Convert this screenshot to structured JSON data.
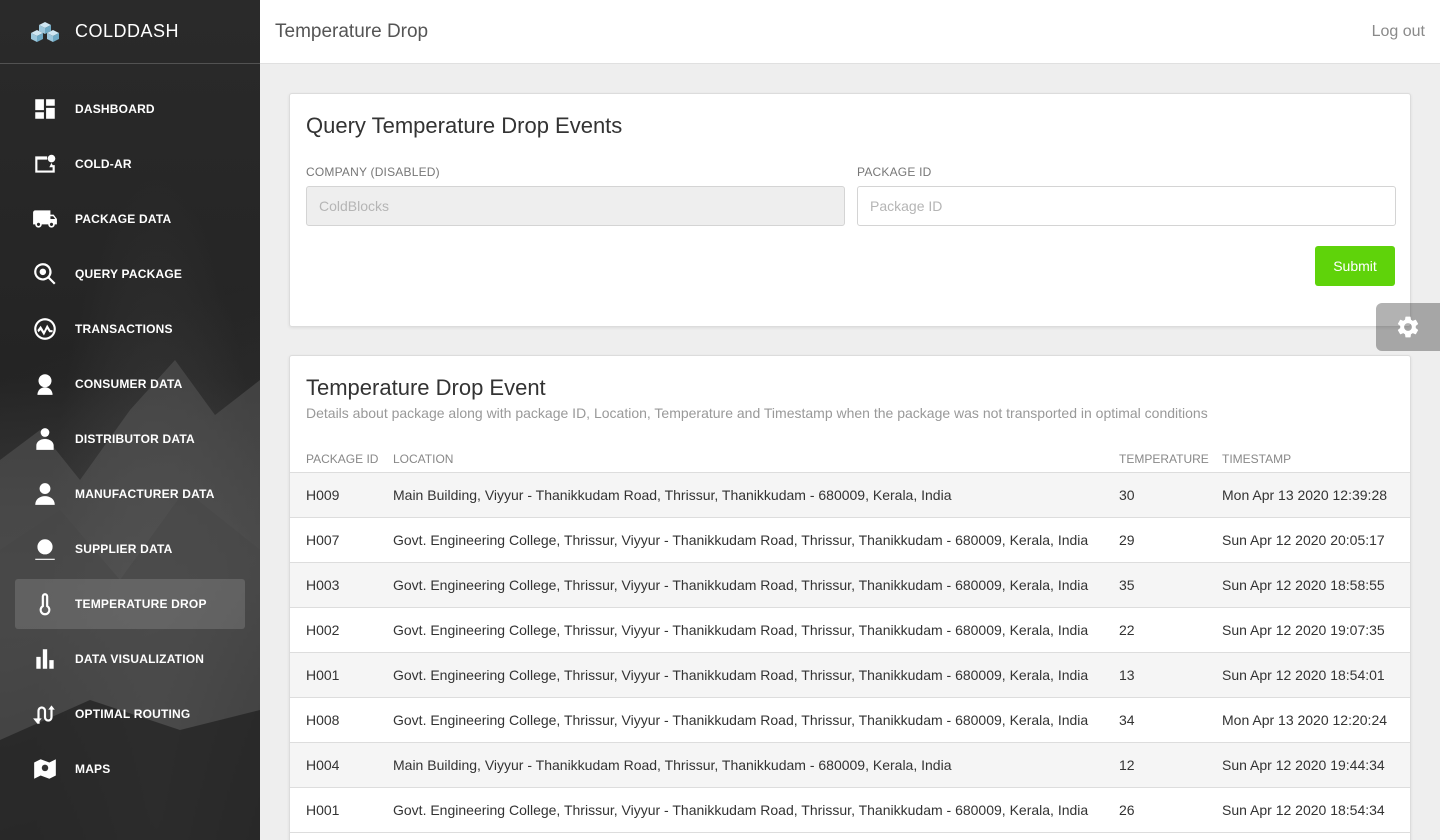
{
  "brand": {
    "name": "COLDDASH"
  },
  "sidebar": {
    "items": [
      {
        "label": "DASHBOARD",
        "icon": "dashboard-icon"
      },
      {
        "label": "COLD-AR",
        "icon": "cold-ar-icon"
      },
      {
        "label": "PACKAGE DATA",
        "icon": "truck-icon"
      },
      {
        "label": "QUERY PACKAGE",
        "icon": "search-icon"
      },
      {
        "label": "TRANSACTIONS",
        "icon": "transactions-icon"
      },
      {
        "label": "CONSUMER DATA",
        "icon": "consumer-icon"
      },
      {
        "label": "DISTRIBUTOR DATA",
        "icon": "distributor-icon"
      },
      {
        "label": "MANUFACTURER DATA",
        "icon": "person-icon"
      },
      {
        "label": "SUPPLIER DATA",
        "icon": "supplier-icon"
      },
      {
        "label": "TEMPERATURE DROP",
        "icon": "thermometer-icon",
        "active": true
      },
      {
        "label": "DATA VISUALIZATION",
        "icon": "bar-chart-icon"
      },
      {
        "label": "OPTIMAL ROUTING",
        "icon": "routing-icon"
      },
      {
        "label": "MAPS",
        "icon": "map-icon"
      }
    ]
  },
  "header": {
    "title": "Temperature Drop",
    "logout": "Log out"
  },
  "query": {
    "title": "Query Temperature Drop Events",
    "company_label": "COMPANY (DISABLED)",
    "company_value": "ColdBlocks",
    "package_label": "PACKAGE ID",
    "package_placeholder": "Package ID",
    "submit_label": "Submit"
  },
  "events": {
    "title": "Temperature Drop Event",
    "description": "Details about package along with package ID, Location, Temperature and Timestamp when the package was not transported in optimal conditions",
    "columns": [
      "PACKAGE ID",
      "LOCATION",
      "TEMPERATURE",
      "TIMESTAMP"
    ],
    "rows": [
      [
        "H009",
        "Main Building, Viyyur - Thanikkudam Road, Thrissur, Thanikkudam - 680009, Kerala, India",
        "30",
        "Mon Apr 13 2020 12:39:28"
      ],
      [
        "H007",
        "Govt. Engineering College, Thrissur, Viyyur - Thanikkudam Road, Thrissur, Thanikkudam - 680009, Kerala, India",
        "29",
        "Sun Apr 12 2020 20:05:17"
      ],
      [
        "H003",
        "Govt. Engineering College, Thrissur, Viyyur - Thanikkudam Road, Thrissur, Thanikkudam - 680009, Kerala, India",
        "35",
        "Sun Apr 12 2020 18:58:55"
      ],
      [
        "H002",
        "Govt. Engineering College, Thrissur, Viyyur - Thanikkudam Road, Thrissur, Thanikkudam - 680009, Kerala, India",
        "22",
        "Sun Apr 12 2020 19:07:35"
      ],
      [
        "H001",
        "Govt. Engineering College, Thrissur, Viyyur - Thanikkudam Road, Thrissur, Thanikkudam - 680009, Kerala, India",
        "13",
        "Sun Apr 12 2020 18:54:01"
      ],
      [
        "H008",
        "Govt. Engineering College, Thrissur, Viyyur - Thanikkudam Road, Thrissur, Thanikkudam - 680009, Kerala, India",
        "34",
        "Mon Apr 13 2020 12:20:24"
      ],
      [
        "H004",
        "Main Building, Viyyur - Thanikkudam Road, Thrissur, Thanikkudam - 680009, Kerala, India",
        "12",
        "Sun Apr 12 2020 19:44:34"
      ],
      [
        "H001",
        "Govt. Engineering College, Thrissur, Viyyur - Thanikkudam Road, Thrissur, Thanikkudam - 680009, Kerala, India",
        "26",
        "Sun Apr 12 2020 18:54:34"
      ]
    ]
  },
  "colors": {
    "accent": "#5fd30a",
    "sidebar_bg": "#2a2a2a"
  },
  "fab": {
    "icon": "gear-icon"
  }
}
